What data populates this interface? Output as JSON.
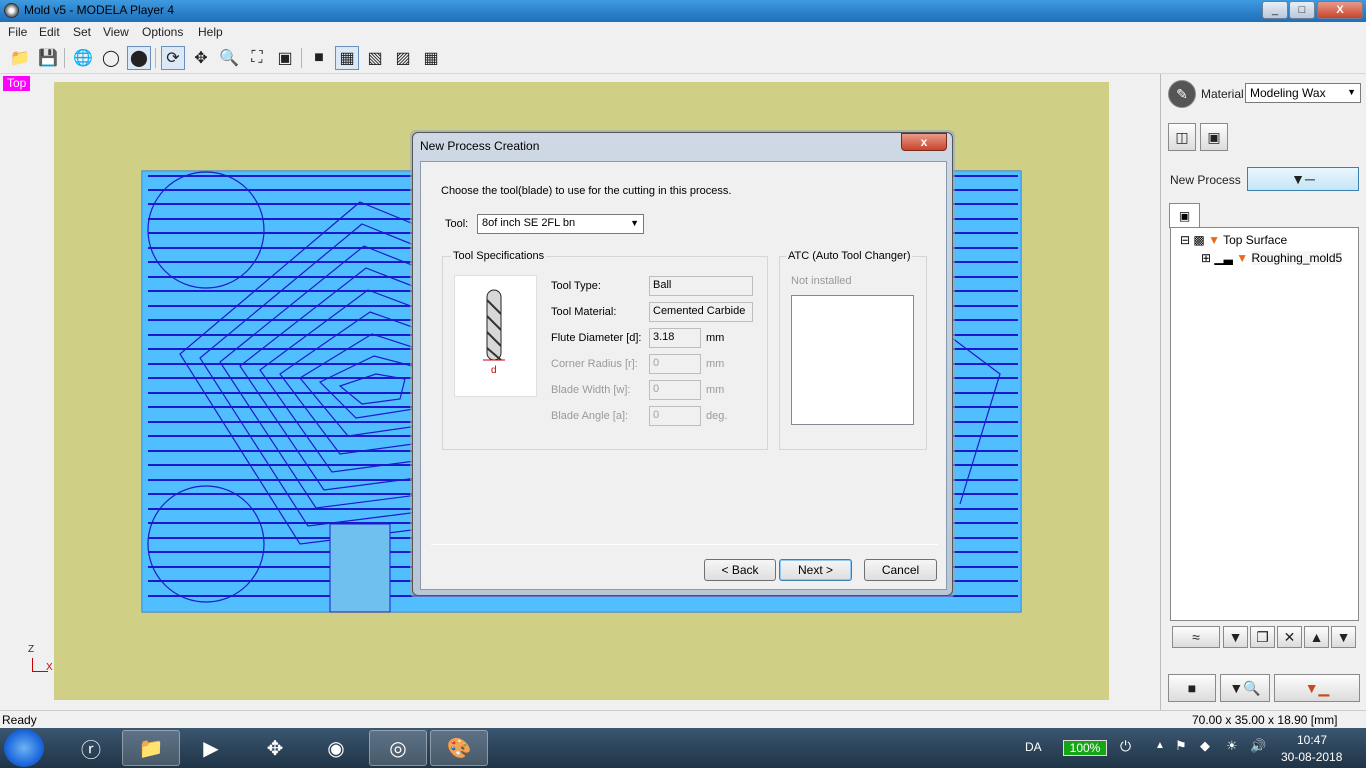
{
  "window": {
    "title": "Mold v5 - MODELA Player 4",
    "min": "_",
    "max": "□",
    "close": "X"
  },
  "menu": [
    "File",
    "Edit",
    "Set",
    "View",
    "Options",
    "Help"
  ],
  "toolbar": {
    "icons": [
      "open-icon",
      "save-icon",
      "wireframe-icon",
      "globe-icon",
      "shaded-icon",
      "rotate-icon",
      "pan-icon",
      "zoom-icon",
      "fit-icon",
      "zoom-box-icon",
      "view-front-icon",
      "view-top-icon",
      "view-right-icon",
      "view-iso-icon",
      "four-views-icon"
    ]
  },
  "viewport": {
    "view_label": "Top",
    "axis_z": "Z",
    "axis_x": "X"
  },
  "right_panel": {
    "material_label": "Material",
    "material_value": "Modeling Wax",
    "new_process_label": "New Process",
    "tree": {
      "root": "Top Surface",
      "child": "Roughing_mold5"
    }
  },
  "status": {
    "left": "Ready",
    "right": "70.00 x 35.00 x 18.90 [mm]"
  },
  "dialog": {
    "title": "New Process Creation",
    "close": "x",
    "instruction": "Choose the tool(blade) to use for the cutting in this process.",
    "tool_label": "Tool:",
    "tool_value": "8of inch SE 2FL bn",
    "spec_group": "Tool Specifications",
    "dimension_letter": "d",
    "specs": {
      "type_label": "Tool Type:",
      "type_value": "Ball",
      "material_label": "Tool Material:",
      "material_value": "Cemented Carbide",
      "flute_label": "Flute Diameter [d]:",
      "flute_value": "3.18",
      "flute_unit": "mm",
      "corner_label": "Corner Radius [r]:",
      "corner_value": "0",
      "corner_unit": "mm",
      "blade_width_label": "Blade Width [w]:",
      "blade_width_value": "0",
      "blade_width_unit": "mm",
      "blade_angle_label": "Blade Angle [a]:",
      "blade_angle_value": "0",
      "blade_angle_unit": "deg."
    },
    "atc_group": "ATC (Auto Tool Changer)",
    "atc_status": "Not installed",
    "buttons": {
      "back": "< Back",
      "next": "Next >",
      "cancel": "Cancel"
    }
  },
  "taskbar": {
    "lang": "DA",
    "battery": "100%",
    "time": "10:47",
    "date": "30-08-2018"
  }
}
